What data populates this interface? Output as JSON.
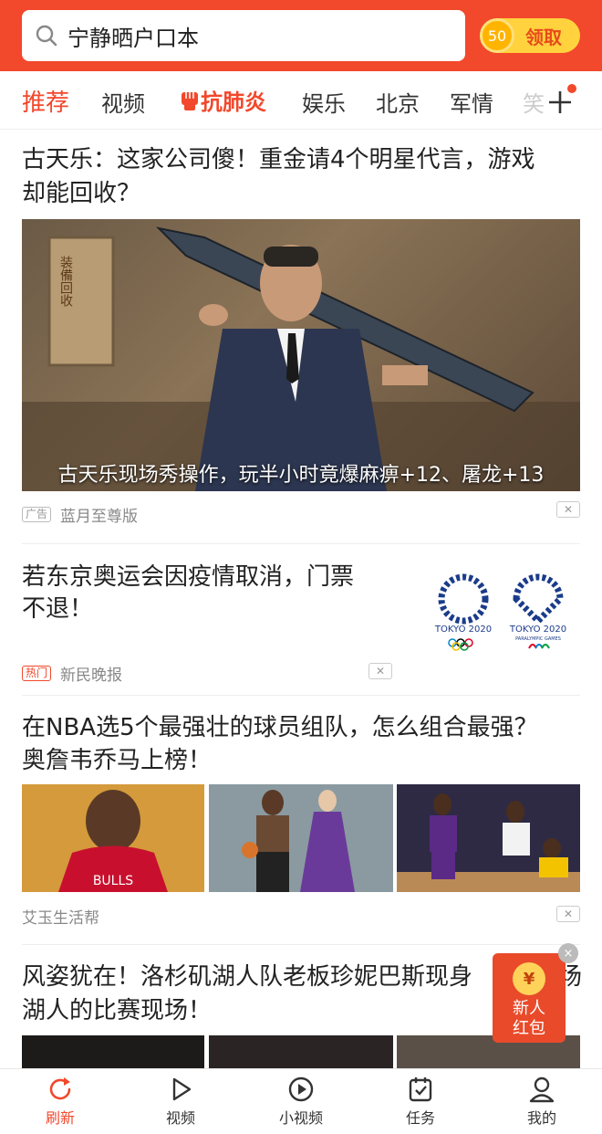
{
  "search": {
    "query": "宁静晒户口本",
    "icon": "search-icon"
  },
  "coin": {
    "amount": "50",
    "label": "领取"
  },
  "tabs": [
    {
      "label": "推荐"
    },
    {
      "label": "视频"
    },
    {
      "label": "抗肺炎"
    },
    {
      "label": "娱乐"
    },
    {
      "label": "北京"
    },
    {
      "label": "军情"
    },
    {
      "label": "笑"
    }
  ],
  "feed": {
    "item1": {
      "title_line1": "古天乐：这家公司傻！重金请4个明星代言，游戏",
      "title_line2": "却能回收？",
      "image_caption": "古天乐现场秀操作，玩半小时竟爆麻痹+12、屠龙+13",
      "sign_text": "装備回收",
      "tag": "广告",
      "source": "蓝月至尊版"
    },
    "item2": {
      "title_line1": "若东京奥运会因疫情取消，门票",
      "title_line2": "不退！",
      "logo1": "TOKYO 2020",
      "logo2": "TOKYO 2020",
      "logo2_sub": "PARALYMPIC GAMES",
      "tag": "热门",
      "source": "新民晚报"
    },
    "item3": {
      "title_line1": "在NBA选5个最强壮的球员组队，怎么组合最强？",
      "title_line2": "奥詹韦乔马上榜！",
      "jersey_text": "BULLS",
      "source": "艾玉生活帮"
    },
    "item4": {
      "title_line1": "风姿犹在！洛杉矶湖人队老板珍妮巴斯现身",
      "title_line2": "湖人的比赛现场！",
      "title_tail": "场"
    }
  },
  "red_packet": {
    "symbol": "¥",
    "line1": "新人",
    "line2": "红包",
    "close": "×"
  },
  "bottom_nav": [
    {
      "label": "刷新",
      "icon": "refresh-icon"
    },
    {
      "label": "视频",
      "icon": "play-icon"
    },
    {
      "label": "小视频",
      "icon": "mini-video-icon"
    },
    {
      "label": "任务",
      "icon": "task-icon"
    },
    {
      "label": "我的",
      "icon": "user-icon"
    }
  ],
  "colors": {
    "brand": "#f2482c",
    "coin": "#ffd23e"
  }
}
